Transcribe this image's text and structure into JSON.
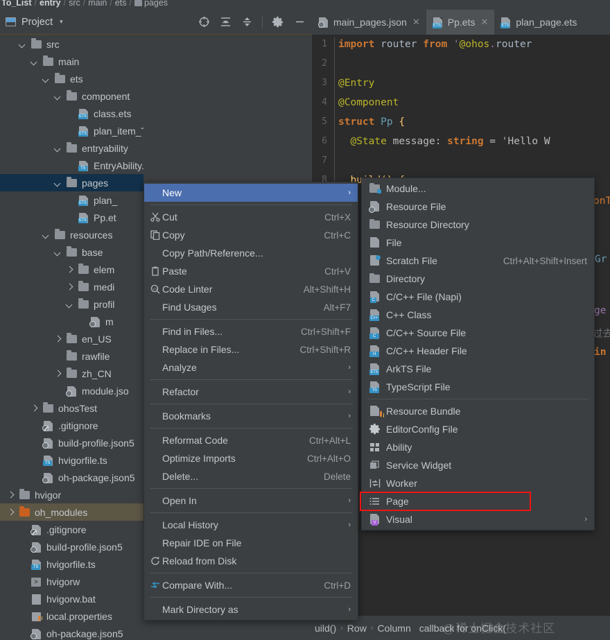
{
  "breadcrumb": {
    "items": [
      "To_List",
      "entry",
      "src",
      "main",
      "ets",
      "pages"
    ],
    "separator": "/"
  },
  "panel": {
    "title": "Project",
    "caret": "▾",
    "tools": [
      {
        "name": "locate-icon",
        "glyph": "⊕"
      },
      {
        "name": "expand-all-icon",
        "glyph": "⬍"
      },
      {
        "name": "collapse-all-icon",
        "glyph": "⬍"
      },
      {
        "name": "settings-gear-icon",
        "glyph": "⚙"
      },
      {
        "name": "hide-panel-icon",
        "glyph": "—"
      }
    ]
  },
  "tree": [
    {
      "label": "src",
      "indent": 1,
      "arrow": "down",
      "icon": "folder",
      "selected": false
    },
    {
      "label": "main",
      "indent": 2,
      "arrow": "down",
      "icon": "folder",
      "selected": false
    },
    {
      "label": "ets",
      "indent": 3,
      "arrow": "down",
      "icon": "folder",
      "selected": false
    },
    {
      "label": "component",
      "indent": 4,
      "arrow": "down",
      "icon": "folder",
      "selected": false
    },
    {
      "label": "class.ets",
      "indent": 5,
      "arrow": "none",
      "icon": "ets",
      "selected": false
    },
    {
      "label": "plan_item_ToDo.ets",
      "indent": 5,
      "arrow": "none",
      "icon": "ets",
      "selected": false
    },
    {
      "label": "entryability",
      "indent": 4,
      "arrow": "down",
      "icon": "folder",
      "selected": false
    },
    {
      "label": "EntryAbility.ts",
      "indent": 5,
      "arrow": "none",
      "icon": "ts",
      "selected": false
    },
    {
      "label": "pages",
      "indent": 4,
      "arrow": "down",
      "icon": "folder",
      "selected": true
    },
    {
      "label": "plan_",
      "indent": 5,
      "arrow": "none",
      "icon": "ets",
      "selected": false
    },
    {
      "label": "Pp.et",
      "indent": 5,
      "arrow": "none",
      "icon": "ets",
      "selected": false
    },
    {
      "label": "resources",
      "indent": 3,
      "arrow": "down",
      "icon": "folder",
      "selected": false
    },
    {
      "label": "base",
      "indent": 4,
      "arrow": "down",
      "icon": "folder",
      "selected": false
    },
    {
      "label": "elem",
      "indent": 5,
      "arrow": "right",
      "icon": "folder",
      "selected": false
    },
    {
      "label": "medi",
      "indent": 5,
      "arrow": "right",
      "icon": "folder",
      "selected": false
    },
    {
      "label": "profil",
      "indent": 5,
      "arrow": "down",
      "icon": "folder",
      "selected": false
    },
    {
      "label": "m",
      "indent": 6,
      "arrow": "none",
      "icon": "json",
      "selected": false
    },
    {
      "label": "en_US",
      "indent": 4,
      "arrow": "right",
      "icon": "folder",
      "selected": false
    },
    {
      "label": "rawfile",
      "indent": 4,
      "arrow": "none",
      "icon": "folder",
      "selected": false
    },
    {
      "label": "zh_CN",
      "indent": 4,
      "arrow": "right",
      "icon": "folder",
      "selected": false
    },
    {
      "label": "module.jso",
      "indent": 4,
      "arrow": "none",
      "icon": "json",
      "selected": false
    },
    {
      "label": "ohosTest",
      "indent": 2,
      "arrow": "right",
      "icon": "folder",
      "selected": false
    },
    {
      "label": ".gitignore",
      "indent": 2,
      "arrow": "none",
      "icon": "git",
      "selected": false
    },
    {
      "label": "build-profile.json5",
      "indent": 2,
      "arrow": "none",
      "icon": "json",
      "selected": false
    },
    {
      "label": "hvigorfile.ts",
      "indent": 2,
      "arrow": "none",
      "icon": "ts",
      "selected": false
    },
    {
      "label": "oh-package.json5",
      "indent": 2,
      "arrow": "none",
      "icon": "json",
      "selected": false
    },
    {
      "label": "hvigor",
      "indent": 0,
      "arrow": "right",
      "icon": "folder",
      "selected": false
    },
    {
      "label": "oh_modules",
      "indent": 0,
      "arrow": "right",
      "icon": "folder-orange",
      "selected": false,
      "selected2": true
    },
    {
      "label": ".gitignore",
      "indent": 1,
      "arrow": "none",
      "icon": "git",
      "selected": false
    },
    {
      "label": "build-profile.json5",
      "indent": 1,
      "arrow": "none",
      "icon": "json",
      "selected": false
    },
    {
      "label": "hvigorfile.ts",
      "indent": 1,
      "arrow": "none",
      "icon": "ts",
      "selected": false
    },
    {
      "label": "hvigorw",
      "indent": 1,
      "arrow": "none",
      "icon": "sh",
      "selected": false
    },
    {
      "label": "hvigorw.bat",
      "indent": 1,
      "arrow": "none",
      "icon": "bat",
      "selected": false
    },
    {
      "label": "local.properties",
      "indent": 1,
      "arrow": "none",
      "icon": "props",
      "selected": false
    },
    {
      "label": "oh-package.json5",
      "indent": 1,
      "arrow": "none",
      "icon": "json",
      "selected": false
    }
  ],
  "editor": {
    "tabs": [
      {
        "label": "main_pages.json",
        "icon": "json-file-icon",
        "active": false,
        "closable": true
      },
      {
        "label": "Pp.ets",
        "icon": "ets-file-icon",
        "active": true,
        "closable": true
      },
      {
        "label": "plan_page.ets",
        "icon": "ets-file-icon",
        "active": false,
        "closable": false
      }
    ],
    "line_numbers": [
      "1",
      "2",
      "3",
      "4",
      "5",
      "6",
      "7",
      "8"
    ],
    "lines": [
      "import router from '@ohos.router'",
      "",
      "@Entry",
      "@Component",
      "struct Pp {",
      "  @State message: string = 'Hello W",
      "",
      "  build() {"
    ],
    "peek_fragments": [
      "onT",
      "Gr",
      "ge",
      "过去",
      "in"
    ]
  },
  "statusbar": {
    "items": [
      "uild()",
      "Row",
      "Column"
    ],
    "trailing": "callback for onClick(",
    "separator": "›",
    "watermark": "@稀土掘金技术社区"
  },
  "context_menu": {
    "groups": [
      [
        {
          "label": "New",
          "mnemonic": "N",
          "icon": null,
          "shortcut": null,
          "submenu": true,
          "highlighted": true
        }
      ],
      [
        {
          "label": "Cut",
          "mnemonic": "t",
          "icon": "scissors-icon",
          "shortcut": "Ctrl+X",
          "submenu": false
        },
        {
          "label": "Copy",
          "mnemonic": "C",
          "icon": "copy-icon",
          "shortcut": "Ctrl+C",
          "submenu": false
        },
        {
          "label": "Copy Path/Reference...",
          "icon": null,
          "shortcut": null,
          "submenu": false
        },
        {
          "label": "Paste",
          "mnemonic": "P",
          "icon": "clipboard-icon",
          "shortcut": "Ctrl+V",
          "submenu": false
        },
        {
          "label": "Code Linter",
          "icon": "code-linter-icon",
          "shortcut": "Alt+Shift+H",
          "submenu": false
        },
        {
          "label": "Find Usages",
          "icon": null,
          "shortcut": "Alt+F7",
          "submenu": false
        }
      ],
      [
        {
          "label": "Find in Files...",
          "icon": null,
          "shortcut": "Ctrl+Shift+F",
          "submenu": false
        },
        {
          "label": "Replace in Files...",
          "mnemonic": "a",
          "icon": null,
          "shortcut": "Ctrl+Shift+R",
          "submenu": false
        },
        {
          "label": "Analyze",
          "mnemonic": "z",
          "icon": null,
          "shortcut": null,
          "submenu": true
        }
      ],
      [
        {
          "label": "Refactor",
          "mnemonic": "R",
          "icon": null,
          "shortcut": null,
          "submenu": true
        }
      ],
      [
        {
          "label": "Bookmarks",
          "icon": null,
          "shortcut": null,
          "submenu": true
        }
      ],
      [
        {
          "label": "Reformat Code",
          "mnemonic": "R",
          "icon": null,
          "shortcut": "Ctrl+Alt+L",
          "submenu": false
        },
        {
          "label": "Optimize Imports",
          "mnemonic": "z",
          "icon": null,
          "shortcut": "Ctrl+Alt+O",
          "submenu": false
        },
        {
          "label": "Delete...",
          "mnemonic": "D",
          "icon": null,
          "shortcut": "Delete",
          "submenu": false
        }
      ],
      [
        {
          "label": "Open In",
          "icon": null,
          "shortcut": null,
          "submenu": true
        }
      ],
      [
        {
          "label": "Local History",
          "mnemonic": "H",
          "icon": null,
          "shortcut": null,
          "submenu": true
        },
        {
          "label": "Repair IDE on File",
          "icon": null,
          "shortcut": null,
          "submenu": false
        },
        {
          "label": "Reload from Disk",
          "icon": "reload-icon",
          "shortcut": null,
          "submenu": false
        }
      ],
      [
        {
          "label": "Compare With...",
          "icon": "compare-icon",
          "shortcut": "Ctrl+D",
          "submenu": false
        }
      ],
      [
        {
          "label": "Mark Directory as",
          "icon": null,
          "shortcut": null,
          "submenu": true
        }
      ]
    ]
  },
  "submenu": {
    "groups": [
      [
        {
          "label": "Module...",
          "icon": "module-icon",
          "shortcut": null,
          "submenu": false
        },
        {
          "label": "Resource File",
          "icon": "resource-file-icon",
          "shortcut": null,
          "submenu": false
        },
        {
          "label": "Resource Directory",
          "icon": "folder-icon",
          "shortcut": null,
          "submenu": false
        },
        {
          "label": "File",
          "icon": "file-icon",
          "shortcut": null,
          "submenu": false
        },
        {
          "label": "Scratch File",
          "icon": "scratch-file-icon",
          "shortcut": "Ctrl+Alt+Shift+Insert",
          "submenu": false
        },
        {
          "label": "Directory",
          "icon": "folder-icon",
          "shortcut": null,
          "submenu": false
        },
        {
          "label": "C/C++ File (Napi)",
          "icon": "c-file-icon",
          "shortcut": null,
          "submenu": false
        },
        {
          "label": "C++ Class",
          "icon": "cpp-class-icon",
          "shortcut": null,
          "submenu": false
        },
        {
          "label": "C/C++ Source File",
          "icon": "c-source-icon",
          "shortcut": null,
          "submenu": false
        },
        {
          "label": "C/C++ Header File",
          "icon": "h-header-icon",
          "shortcut": null,
          "submenu": false
        },
        {
          "label": "ArkTS File",
          "icon": "ets-file-icon",
          "shortcut": null,
          "submenu": false
        },
        {
          "label": "TypeScript File",
          "icon": "ts-file-icon",
          "shortcut": null,
          "submenu": false
        }
      ],
      [
        {
          "label": "Resource Bundle",
          "icon": "resource-bundle-icon",
          "shortcut": null,
          "submenu": false
        },
        {
          "label": "EditorConfig File",
          "icon": "gear-icon",
          "shortcut": null,
          "submenu": false
        },
        {
          "label": "Ability",
          "icon": "ability-icon",
          "shortcut": null,
          "submenu": false
        },
        {
          "label": "Service Widget",
          "icon": "service-widget-icon",
          "shortcut": null,
          "submenu": false
        },
        {
          "label": "Worker",
          "icon": "worker-icon",
          "shortcut": null,
          "submenu": false
        },
        {
          "label": "Page",
          "icon": "page-icon",
          "shortcut": null,
          "submenu": false,
          "boxed": true
        },
        {
          "label": "Visual",
          "icon": "visual-icon",
          "shortcut": null,
          "submenu": true
        }
      ]
    ]
  },
  "colors": {
    "panel_bg": "#3c3f41",
    "editor_bg": "#2b2b2b",
    "selection_blue": "#4b6eaf",
    "tree_selection": "#123049",
    "tree_selection_secondary": "#5c5645",
    "highlight_red": "#f01414",
    "badge_blue": "#3592c4",
    "folder_orange": "#c9601f"
  }
}
